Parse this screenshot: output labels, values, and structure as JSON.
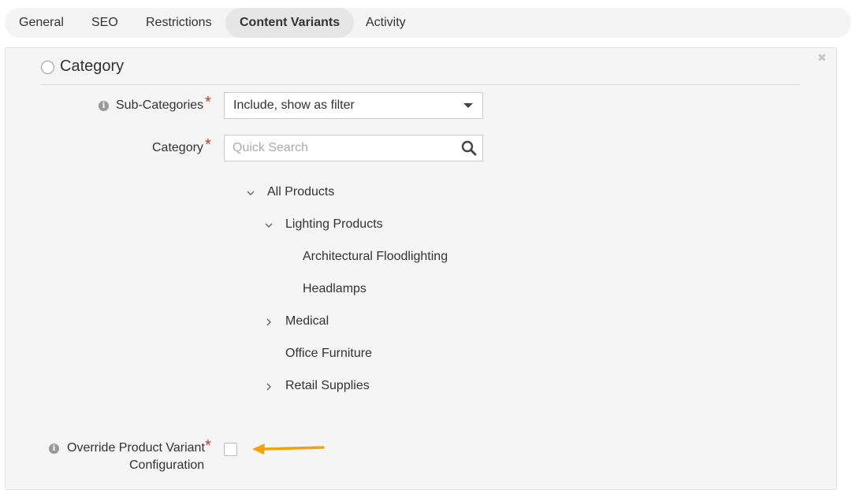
{
  "tabs": [
    {
      "label": "General",
      "active": false
    },
    {
      "label": "SEO",
      "active": false
    },
    {
      "label": "Restrictions",
      "active": false
    },
    {
      "label": "Content Variants",
      "active": true
    },
    {
      "label": "Activity",
      "active": false
    }
  ],
  "section": {
    "title": "Category",
    "close_glyph": "✖"
  },
  "fields": {
    "subcategories": {
      "label": "Sub-Categories",
      "required_mark": "*",
      "value": "Include, show as filter"
    },
    "category": {
      "label": "Category",
      "required_mark": "*",
      "placeholder": "Quick Search"
    },
    "override": {
      "label_line1": "Override Product Variant",
      "label_line2": "Configuration",
      "required_mark": "*",
      "checked": false
    }
  },
  "tree": [
    {
      "label": "All Products",
      "level": 0,
      "toggle": "expanded"
    },
    {
      "label": "Lighting Products",
      "level": 1,
      "toggle": "expanded"
    },
    {
      "label": "Architectural Floodlighting",
      "level": 2,
      "toggle": "none"
    },
    {
      "label": "Headlamps",
      "level": 2,
      "toggle": "none"
    },
    {
      "label": "Medical",
      "level": 1,
      "toggle": "collapsed"
    },
    {
      "label": "Office Furniture",
      "level": 1,
      "toggle": "none"
    },
    {
      "label": "Retail Supplies",
      "level": 1,
      "toggle": "collapsed"
    }
  ],
  "icons": {
    "info": "info-icon",
    "search": "search-icon",
    "close": "close-icon",
    "expanded": "chevron-down-icon",
    "collapsed": "chevron-right-icon"
  },
  "colors": {
    "required": "#c0392b",
    "annotation_arrow": "#f0a30a",
    "active_tab_bg": "#e6e6e6"
  }
}
